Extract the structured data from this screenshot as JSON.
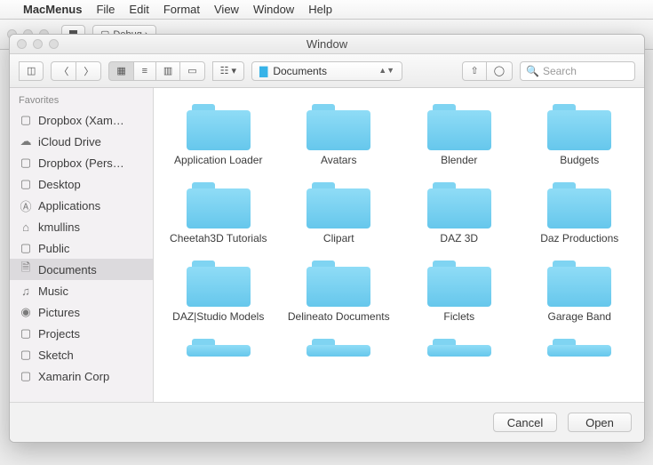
{
  "menubar": {
    "app": "MacMenus",
    "items": [
      "File",
      "Edit",
      "Format",
      "View",
      "Window",
      "Help"
    ]
  },
  "back_toolbar": {
    "scheme": "Debug ›"
  },
  "window": {
    "title": "Window",
    "path_label": "Documents",
    "search_placeholder": "Search",
    "buttons": {
      "cancel": "Cancel",
      "open": "Open"
    }
  },
  "sidebar": {
    "header": "Favorites",
    "items": [
      {
        "icon": "folder",
        "label": "Dropbox (Xam…"
      },
      {
        "icon": "cloud",
        "label": "iCloud Drive"
      },
      {
        "icon": "folder",
        "label": "Dropbox (Pers…"
      },
      {
        "icon": "folder",
        "label": "Desktop"
      },
      {
        "icon": "apps",
        "label": "Applications"
      },
      {
        "icon": "home",
        "label": "kmullins"
      },
      {
        "icon": "folder",
        "label": "Public"
      },
      {
        "icon": "doc",
        "label": "Documents",
        "selected": true
      },
      {
        "icon": "music",
        "label": "Music"
      },
      {
        "icon": "camera",
        "label": "Pictures"
      },
      {
        "icon": "folder",
        "label": "Projects"
      },
      {
        "icon": "folder",
        "label": "Sketch"
      },
      {
        "icon": "folder",
        "label": "Xamarin Corp"
      }
    ]
  },
  "files": [
    "Application Loader",
    "Avatars",
    "Blender",
    "Budgets",
    "Cheetah3D Tutorials",
    "Clipart",
    "DAZ 3D",
    "Daz Productions",
    "DAZ|Studio Models",
    "Delineato Documents",
    "Ficlets",
    "Garage Band"
  ],
  "icons": {
    "folder": "▢",
    "cloud": "☁",
    "apps": "⩍",
    "home": "⌂",
    "doc": "🗎",
    "music": "♫",
    "camera": "📷"
  }
}
